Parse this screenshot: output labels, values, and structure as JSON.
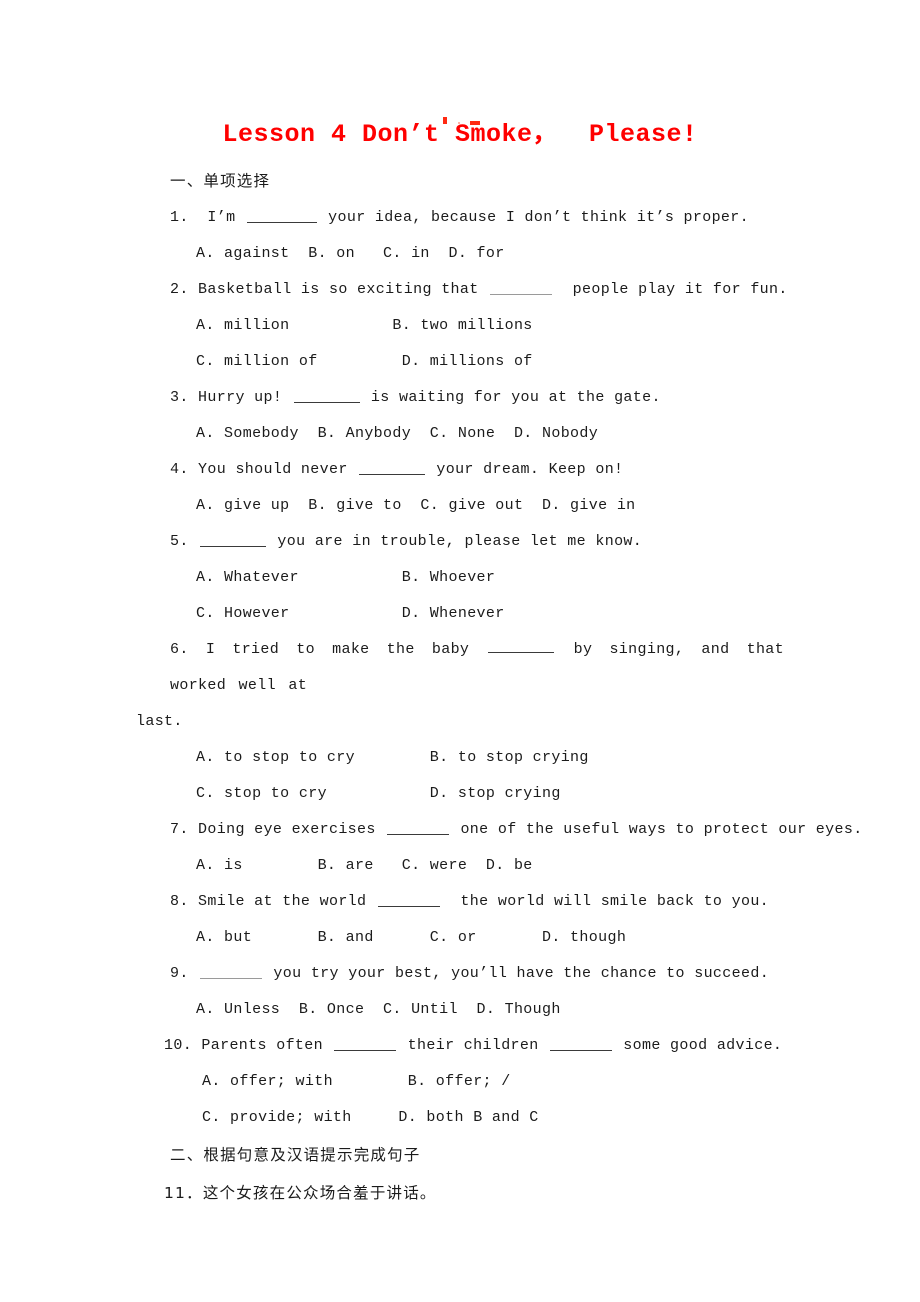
{
  "document": {
    "title": "Lesson 4 Don’t Smoke，  Please!",
    "title_color": "#ff0000",
    "body_color": "#1b1b1b",
    "background": "#ffffff"
  },
  "sections": {
    "one": {
      "heading": "一、单项选择"
    },
    "two": {
      "heading": "二、根据句意及汉语提示完成句子"
    }
  },
  "questions": [
    {
      "number": "1.",
      "stem_before": "1.  I’m ",
      "stem_after": " your idea, because I don’t think it’s proper.",
      "options_lines": [
        "A. against  B. on   C. in  D. for"
      ]
    },
    {
      "number": "2.",
      "stem_before": "2. Basketball is so exciting that ",
      "stem_after": "  people play it for fun.",
      "options_lines": [
        "A. million           B. two millions",
        "C. million of         D. millions of"
      ]
    },
    {
      "number": "3.",
      "stem_before": "3. Hurry up! ",
      "stem_after": " is waiting for you at the gate.",
      "options_lines": [
        "A. Somebody  B. Anybody  C. None  D. Nobody"
      ]
    },
    {
      "number": "4.",
      "stem_before": "4. You should never ",
      "stem_after": " your dream. Keep on!",
      "options_lines": [
        "A. give up  B. give to  C. give out  D. give in"
      ]
    },
    {
      "number": "5.",
      "stem_before": "5. ",
      "stem_after": " you are in trouble, please let me know.",
      "options_lines": [
        "A. Whatever           B. Whoever",
        "C. However            D. Whenever"
      ]
    },
    {
      "number": "6.",
      "stem_before": "6. I tried to make the baby ",
      "stem_after": " by singing, and that worked well at",
      "stem_continuation": "last.",
      "options_lines": [
        "A. to stop to cry        B. to stop crying",
        "C. stop to cry           D. stop crying"
      ]
    },
    {
      "number": "7.",
      "stem_before": "7. Doing eye exercises ",
      "stem_after": " one of the useful ways to protect our eyes.",
      "options_lines": [
        "A. is        B. are   C. were  D. be"
      ]
    },
    {
      "number": "8.",
      "stem_before": "8. Smile at the world ",
      "stem_after": "  the world will smile back to you.",
      "options_lines": [
        "A. but       B. and      C. or       D. though"
      ]
    },
    {
      "number": "9.",
      "stem_before": "9. ",
      "stem_after": " you try your best, you’ll have the chance to succeed.",
      "options_lines": [
        "A. Unless  B. Once  C. Until  D. Though"
      ]
    },
    {
      "number": "10.",
      "stem_before": "10. Parents often ",
      "stem_middle": " their children ",
      "stem_after": " some good advice.",
      "options_lines": [
        "A. offer; with        B. offer; /",
        "C. provide; with     D. both B and C"
      ]
    },
    {
      "number": "11.",
      "stem_cn": "11．这个女孩在公众场合羞于讲话。"
    }
  ]
}
